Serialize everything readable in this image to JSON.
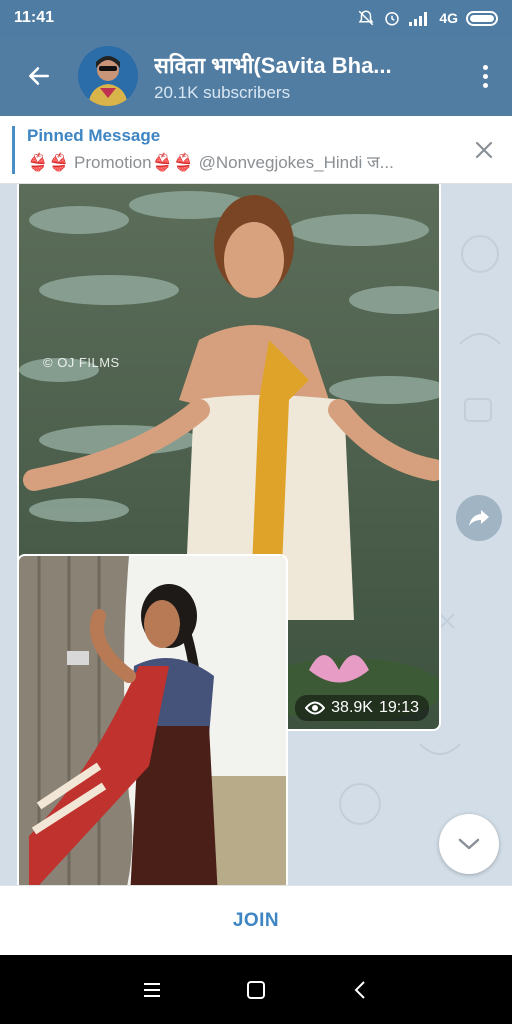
{
  "status_bar": {
    "time": "11:41",
    "network": "4G"
  },
  "header": {
    "title": "सविता भाभी(Savita Bha...",
    "subscribers": "20.1K subscribers"
  },
  "pinned": {
    "title": "Pinned Message",
    "body": "👙👙 Promotion👙👙  @Nonvegjokes_Hindi  ज..."
  },
  "messages": [
    {
      "watermark": "© OJ FILMS",
      "views": "38.9K",
      "time": "19:13"
    }
  ],
  "join": {
    "label": "JOIN"
  },
  "colors": {
    "header": "#527da3",
    "accent": "#3e85c3",
    "chat_bg": "#d2dde7"
  },
  "icons": {
    "back": "arrow-left-icon",
    "menu": "more-vertical-icon",
    "close": "close-icon",
    "views": "eye-icon",
    "share": "share-icon",
    "scroll": "chevron-down-icon"
  }
}
